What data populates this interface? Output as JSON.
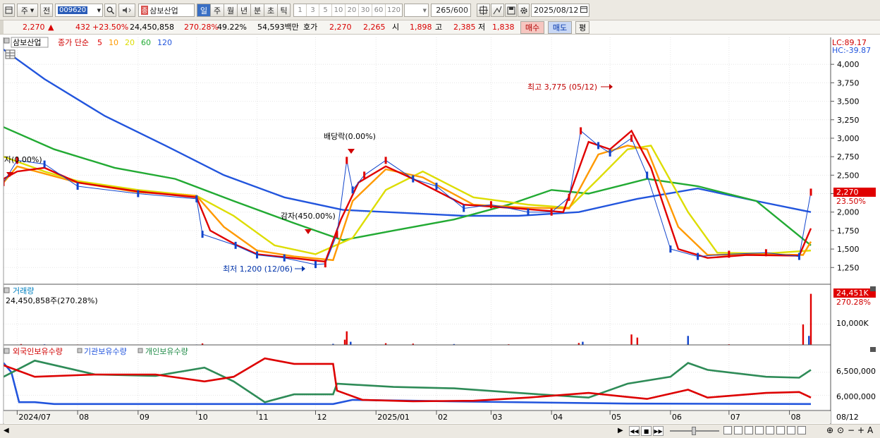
{
  "toolbar": {
    "period_type": "주",
    "prev_label": "전",
    "stock_code": "009620",
    "stock_badge": "종",
    "stock_name": "삼보산업",
    "periods": [
      "일",
      "주",
      "월",
      "년",
      "분",
      "초",
      "틱"
    ],
    "active_period": "일",
    "tick_buttons": [
      "1",
      "3",
      "5",
      "10",
      "20",
      "30",
      "60",
      "120"
    ],
    "count_value": "265",
    "count_total": "/600",
    "date": "2025/08/12"
  },
  "quote": {
    "price": "2,270",
    "arrow": "▲",
    "change": "432",
    "change_pct": "+23.50%",
    "volume": "24,450,858",
    "volume_ratio": "270.28%",
    "turnover_pct": "49.22%",
    "amount": "54,593백만",
    "ask_label": "호가",
    "ask": "2,270",
    "bid": "2,265",
    "open_label": "시",
    "open": "1,898",
    "high_label": "고",
    "high": "2,385",
    "low_label": "저",
    "low": "1,838",
    "buy_label": "매수",
    "sell_label": "매도",
    "eval_label": "평"
  },
  "legend": {
    "stock": "삼보산업",
    "ma_title": "종가 단순",
    "ma": [
      {
        "p": "5",
        "c": "#e00000"
      },
      {
        "p": "10",
        "c": "#ff9900"
      },
      {
        "p": "20",
        "c": "#dddd00"
      },
      {
        "p": "60",
        "c": "#22aa33"
      },
      {
        "p": "120",
        "c": "#2255dd"
      }
    ]
  },
  "right_axis": {
    "lc": "LC:89.17",
    "hc": "HC:-39.87",
    "price_ticks": [
      "4,000",
      "3,750",
      "3,500",
      "3,250",
      "3,000",
      "2,750",
      "2,500",
      "2,250",
      "2,000",
      "1,750",
      "1,500",
      "1,250"
    ],
    "current_price": "2,270",
    "current_pct": "23.50%",
    "vol_tick": "10,000K",
    "current_vol": "24,451K",
    "current_vol_pct": "270.28%",
    "own_ticks": [
      "6,500,000",
      "6,000,000"
    ]
  },
  "annotations": {
    "high": "최고 3,775 (05/12)",
    "low": "최저 1,200 (12/06)",
    "dividend": "배당락(0.00%)",
    "reduction": "감자(450.00%)",
    "capital": "자(0.00%)"
  },
  "volume_panel": {
    "title": "거래량",
    "value": "24,450,858주(270.28%)"
  },
  "ownership_panel": {
    "foreign": "외국인보유수량",
    "institution": "기관보유수량",
    "individual": "개인보유수량"
  },
  "x_labels": [
    {
      "t": "2024/07",
      "d": "2024-07-01"
    },
    {
      "t": "08",
      "d": "2024-08-01"
    },
    {
      "t": "09",
      "d": "2024-09-01"
    },
    {
      "t": "10",
      "d": "2024-10-01"
    },
    {
      "t": "11",
      "d": "2024-11-01"
    },
    {
      "t": "12",
      "d": "2024-12-01"
    },
    {
      "t": "2025/01",
      "d": "2025-01-01"
    },
    {
      "t": "02",
      "d": "2025-02-01"
    },
    {
      "t": "03",
      "d": "2025-03-01"
    },
    {
      "t": "04",
      "d": "2025-04-01"
    },
    {
      "t": "05",
      "d": "2025-05-01"
    },
    {
      "t": "06",
      "d": "2025-06-01"
    },
    {
      "t": "07",
      "d": "2025-07-01"
    },
    {
      "t": "08",
      "d": "2025-08-01"
    }
  ],
  "x_right_label": "08/12",
  "colors": {
    "up": "#e00000",
    "down": "#1144cc"
  },
  "chart_data": {
    "type": "line",
    "x_unit": "date",
    "x_start": "2024-06-24",
    "x_end": "2025-08-12",
    "price_ylim": [
      1100,
      4250
    ],
    "vol_max": 26000000,
    "own_ylim": [
      5700000,
      7000000
    ],
    "price": [
      [
        "2024-06-24",
        2400
      ],
      [
        "2024-07-01",
        2700
      ],
      [
        "2024-07-15",
        2650
      ],
      [
        "2024-08-01",
        2350
      ],
      [
        "2024-09-01",
        2250
      ],
      [
        "2024-10-01",
        2180
      ],
      [
        "2024-10-04",
        1700
      ],
      [
        "2024-10-21",
        1550
      ],
      [
        "2024-11-01",
        1420
      ],
      [
        "2024-11-15",
        1380
      ],
      [
        "2024-12-01",
        1290
      ],
      [
        "2024-12-06",
        1300
      ],
      [
        "2024-12-12",
        1700
      ],
      [
        "2024-12-17",
        2700
      ],
      [
        "2024-12-20",
        2300
      ],
      [
        "2024-12-26",
        2500
      ],
      [
        "2025-01-06",
        2700
      ],
      [
        "2025-01-20",
        2450
      ],
      [
        "2025-02-01",
        2350
      ],
      [
        "2025-02-15",
        2050
      ],
      [
        "2025-03-01",
        2100
      ],
      [
        "2025-03-20",
        2000
      ],
      [
        "2025-04-01",
        2000
      ],
      [
        "2025-04-10",
        2200
      ],
      [
        "2025-04-16",
        3100
      ],
      [
        "2025-04-25",
        2900
      ],
      [
        "2025-05-01",
        2800
      ],
      [
        "2025-05-12",
        3000
      ],
      [
        "2025-05-20",
        2500
      ],
      [
        "2025-06-01",
        1500
      ],
      [
        "2025-06-15",
        1400
      ],
      [
        "2025-07-01",
        1430
      ],
      [
        "2025-07-20",
        1450
      ],
      [
        "2025-08-06",
        1400
      ],
      [
        "2025-08-12",
        2270
      ]
    ],
    "ma5": [
      [
        "2024-06-24",
        2450
      ],
      [
        "2024-07-01",
        2550
      ],
      [
        "2024-07-15",
        2600
      ],
      [
        "2024-08-01",
        2400
      ],
      [
        "2024-09-01",
        2280
      ],
      [
        "2024-10-01",
        2200
      ],
      [
        "2024-10-08",
        1750
      ],
      [
        "2024-10-21",
        1560
      ],
      [
        "2024-11-01",
        1430
      ],
      [
        "2024-11-15",
        1390
      ],
      [
        "2024-12-06",
        1330
      ],
      [
        "2024-12-14",
        1900
      ],
      [
        "2024-12-23",
        2400
      ],
      [
        "2025-01-06",
        2620
      ],
      [
        "2025-01-20",
        2450
      ],
      [
        "2025-02-15",
        2100
      ],
      [
        "2025-03-15",
        2050
      ],
      [
        "2025-04-07",
        2000
      ],
      [
        "2025-04-20",
        2950
      ],
      [
        "2025-05-01",
        2850
      ],
      [
        "2025-05-12",
        3100
      ],
      [
        "2025-05-22",
        2600
      ],
      [
        "2025-06-05",
        1500
      ],
      [
        "2025-06-20",
        1380
      ],
      [
        "2025-07-10",
        1420
      ],
      [
        "2025-08-06",
        1410
      ],
      [
        "2025-08-12",
        1780
      ]
    ],
    "ma10": [
      [
        "2024-06-24",
        2400
      ],
      [
        "2024-07-01",
        2620
      ],
      [
        "2024-08-01",
        2400
      ],
      [
        "2024-09-01",
        2270
      ],
      [
        "2024-10-01",
        2220
      ],
      [
        "2024-10-15",
        1800
      ],
      [
        "2024-11-01",
        1480
      ],
      [
        "2024-11-20",
        1400
      ],
      [
        "2024-12-10",
        1350
      ],
      [
        "2024-12-20",
        2150
      ],
      [
        "2025-01-06",
        2580
      ],
      [
        "2025-01-25",
        2470
      ],
      [
        "2025-02-20",
        2100
      ],
      [
        "2025-03-20",
        2060
      ],
      [
        "2025-04-10",
        2050
      ],
      [
        "2025-04-25",
        2780
      ],
      [
        "2025-05-10",
        2900
      ],
      [
        "2025-05-20",
        2850
      ],
      [
        "2025-06-05",
        1800
      ],
      [
        "2025-06-20",
        1420
      ],
      [
        "2025-07-15",
        1430
      ],
      [
        "2025-08-08",
        1420
      ],
      [
        "2025-08-12",
        1600
      ]
    ],
    "ma20": [
      [
        "2024-06-24",
        2750
      ],
      [
        "2024-07-15",
        2550
      ],
      [
        "2024-08-01",
        2420
      ],
      [
        "2024-09-01",
        2300
      ],
      [
        "2024-10-01",
        2220
      ],
      [
        "2024-10-20",
        1950
      ],
      [
        "2024-11-10",
        1550
      ],
      [
        "2024-12-01",
        1430
      ],
      [
        "2024-12-20",
        1650
      ],
      [
        "2025-01-06",
        2300
      ],
      [
        "2025-01-25",
        2550
      ],
      [
        "2025-02-20",
        2200
      ],
      [
        "2025-03-20",
        2100
      ],
      [
        "2025-04-10",
        2060
      ],
      [
        "2025-04-25",
        2450
      ],
      [
        "2025-05-10",
        2850
      ],
      [
        "2025-05-22",
        2900
      ],
      [
        "2025-06-10",
        2000
      ],
      [
        "2025-06-25",
        1450
      ],
      [
        "2025-07-20",
        1440
      ],
      [
        "2025-08-12",
        1480
      ]
    ],
    "ma60": [
      [
        "2024-06-24",
        3150
      ],
      [
        "2024-07-20",
        2850
      ],
      [
        "2024-08-20",
        2600
      ],
      [
        "2024-09-20",
        2450
      ],
      [
        "2024-10-20",
        2150
      ],
      [
        "2024-11-20",
        1850
      ],
      [
        "2024-12-15",
        1620
      ],
      [
        "2025-01-10",
        1750
      ],
      [
        "2025-02-10",
        1900
      ],
      [
        "2025-03-10",
        2100
      ],
      [
        "2025-04-01",
        2300
      ],
      [
        "2025-04-20",
        2250
      ],
      [
        "2025-05-20",
        2450
      ],
      [
        "2025-06-15",
        2350
      ],
      [
        "2025-07-15",
        2150
      ],
      [
        "2025-08-12",
        1550
      ]
    ],
    "ma120": [
      [
        "2024-06-24",
        4200
      ],
      [
        "2024-07-15",
        3800
      ],
      [
        "2024-08-15",
        3300
      ],
      [
        "2024-09-15",
        2900
      ],
      [
        "2024-10-15",
        2500
      ],
      [
        "2024-11-15",
        2200
      ],
      [
        "2024-12-15",
        2030
      ],
      [
        "2025-01-15",
        1990
      ],
      [
        "2025-02-15",
        1950
      ],
      [
        "2025-03-15",
        1950
      ],
      [
        "2025-04-15",
        2000
      ],
      [
        "2025-05-15",
        2180
      ],
      [
        "2025-06-15",
        2320
      ],
      [
        "2025-07-15",
        2150
      ],
      [
        "2025-08-12",
        2000
      ]
    ],
    "volume": [
      [
        "2024-07-03",
        400000
      ],
      [
        "2024-07-15",
        300000
      ],
      [
        "2024-08-01",
        200000
      ],
      [
        "2024-09-01",
        150000
      ],
      [
        "2024-10-01",
        200000
      ],
      [
        "2024-10-04",
        700000
      ],
      [
        "2024-11-01",
        150000
      ],
      [
        "2024-12-10",
        500000
      ],
      [
        "2024-12-16",
        2500000
      ],
      [
        "2024-12-17",
        6500000
      ],
      [
        "2024-12-19",
        1500000
      ],
      [
        "2025-01-06",
        800000
      ],
      [
        "2025-01-20",
        600000
      ],
      [
        "2025-02-10",
        400000
      ],
      [
        "2025-03-10",
        300000
      ],
      [
        "2025-04-15",
        900000
      ],
      [
        "2025-04-17",
        1500000
      ],
      [
        "2025-05-12",
        5000000
      ],
      [
        "2025-05-15",
        3500000
      ],
      [
        "2025-06-10",
        4300000
      ],
      [
        "2025-07-01",
        300000
      ],
      [
        "2025-08-08",
        9800000
      ],
      [
        "2025-08-11",
        4300000
      ],
      [
        "2025-08-12",
        24450858
      ]
    ],
    "foreign": [
      [
        "2024-06-24",
        6650000
      ],
      [
        "2024-07-10",
        6400000
      ],
      [
        "2024-08-10",
        6450000
      ],
      [
        "2024-09-10",
        6450000
      ],
      [
        "2024-10-05",
        6300000
      ],
      [
        "2024-10-20",
        6400000
      ],
      [
        "2024-11-05",
        6800000
      ],
      [
        "2024-11-20",
        6680000
      ],
      [
        "2024-12-10",
        6680000
      ],
      [
        "2024-12-12",
        6100000
      ],
      [
        "2024-12-25",
        5900000
      ],
      [
        "2025-01-20",
        5870000
      ],
      [
        "2025-02-20",
        5880000
      ],
      [
        "2025-03-20",
        5950000
      ],
      [
        "2025-04-20",
        6050000
      ],
      [
        "2025-05-20",
        5920000
      ],
      [
        "2025-06-10",
        6120000
      ],
      [
        "2025-06-20",
        5950000
      ],
      [
        "2025-07-20",
        6050000
      ],
      [
        "2025-08-06",
        6070000
      ],
      [
        "2025-08-12",
        5950000
      ]
    ],
    "institution": [
      [
        "2024-06-24",
        6700000
      ],
      [
        "2024-06-28",
        6500000
      ],
      [
        "2024-07-02",
        5850000
      ],
      [
        "2024-07-10",
        5850000
      ],
      [
        "2024-07-20",
        5810000
      ],
      [
        "2024-12-10",
        5810000
      ],
      [
        "2024-12-20",
        5900000
      ],
      [
        "2025-02-20",
        5860000
      ],
      [
        "2025-05-10",
        5820000
      ],
      [
        "2025-08-12",
        5810000
      ]
    ],
    "individual": [
      [
        "2024-06-24",
        6400000
      ],
      [
        "2024-07-10",
        6750000
      ],
      [
        "2024-08-10",
        6450000
      ],
      [
        "2024-09-10",
        6420000
      ],
      [
        "2024-10-05",
        6600000
      ],
      [
        "2024-10-20",
        6300000
      ],
      [
        "2024-11-05",
        5850000
      ],
      [
        "2024-11-20",
        6020000
      ],
      [
        "2024-12-10",
        6020000
      ],
      [
        "2024-12-12",
        6250000
      ],
      [
        "2025-01-10",
        6180000
      ],
      [
        "2025-02-10",
        6150000
      ],
      [
        "2025-03-15",
        6050000
      ],
      [
        "2025-04-20",
        5950000
      ],
      [
        "2025-05-10",
        6250000
      ],
      [
        "2025-06-01",
        6400000
      ],
      [
        "2025-06-10",
        6700000
      ],
      [
        "2025-06-20",
        6550000
      ],
      [
        "2025-07-20",
        6400000
      ],
      [
        "2025-08-06",
        6380000
      ],
      [
        "2025-08-12",
        6550000
      ]
    ]
  }
}
